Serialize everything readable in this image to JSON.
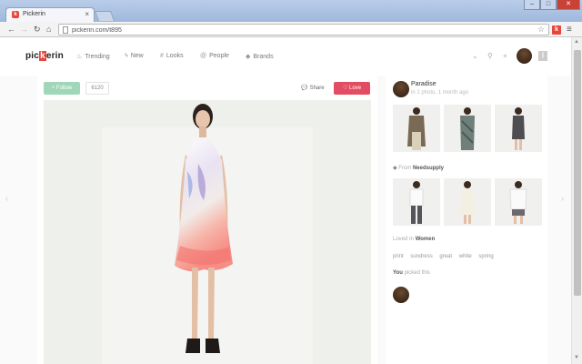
{
  "browser": {
    "tab_title": "Pickerin",
    "tab_close": "×",
    "url": "pickerin.com/t895",
    "favicon_letter": "k",
    "extension_letter": "k"
  },
  "site": {
    "logo_left": "pic",
    "logo_k": "k",
    "logo_right": "erin",
    "nav": [
      "Trending",
      "New",
      "Looks",
      "People",
      "Brands"
    ],
    "header_badge": "||"
  },
  "post": {
    "follow_label": "Follow",
    "count": "6120",
    "share_label": "Share",
    "love_label": "Love"
  },
  "sidebar": {
    "user_name": "Paradise",
    "user_sub": "in 1 photo, 1 month ago",
    "from_prefix": "From",
    "from_brand": "Needsupply",
    "worn_prefix": "Loved In",
    "worn_category": "Women",
    "tags": [
      "print",
      "sundress",
      "great",
      "white",
      "spring"
    ],
    "you_label": "You",
    "you_suffix": "picked this"
  },
  "colors": {
    "brand_red": "#e8463d",
    "follow_green": "#9fd7b8",
    "love_pink": "#e34d63"
  }
}
